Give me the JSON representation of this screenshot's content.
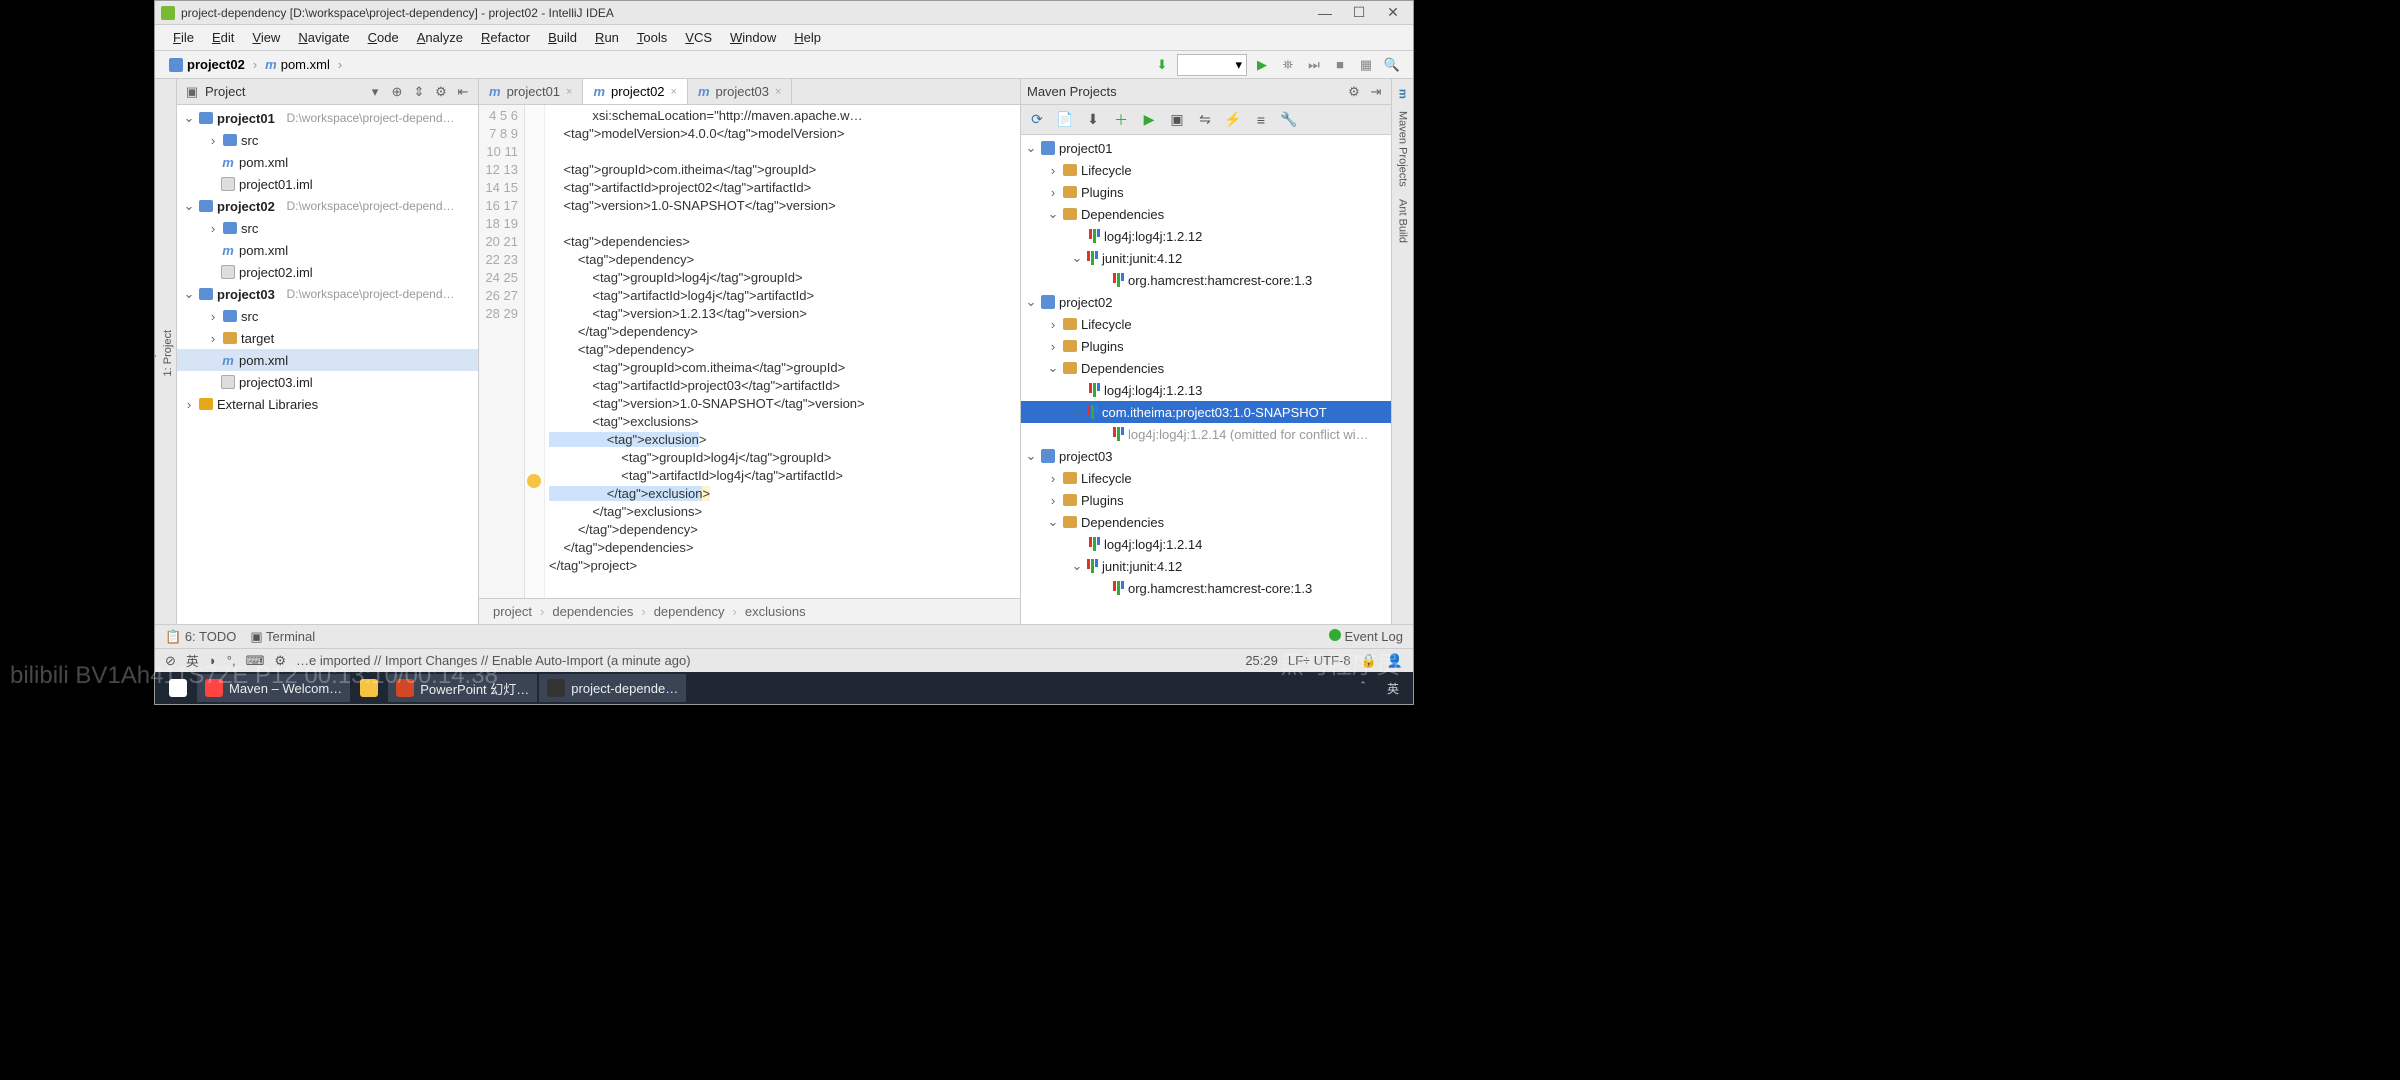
{
  "window": {
    "title": "project-dependency [D:\\workspace\\project-dependency] - project02 - IntelliJ IDEA"
  },
  "menu": [
    "File",
    "Edit",
    "View",
    "Navigate",
    "Code",
    "Analyze",
    "Refactor",
    "Build",
    "Run",
    "Tools",
    "VCS",
    "Window",
    "Help"
  ],
  "breadcrumb": {
    "project": "project02",
    "file": "pom.xml"
  },
  "projectPanel": {
    "title": "Project"
  },
  "tree": {
    "p1": {
      "name": "project01",
      "path": "D:\\workspace\\project-depend…"
    },
    "p1_src": "src",
    "p1_pom": "pom.xml",
    "p1_iml": "project01.iml",
    "p2": {
      "name": "project02",
      "path": "D:\\workspace\\project-depend…"
    },
    "p2_src": "src",
    "p2_pom": "pom.xml",
    "p2_iml": "project02.iml",
    "p3": {
      "name": "project03",
      "path": "D:\\workspace\\project-depend…"
    },
    "p3_src": "src",
    "p3_target": "target",
    "p3_pom": "pom.xml",
    "p3_iml": "project03.iml",
    "ext": "External Libraries"
  },
  "tabs": [
    "project01",
    "project02",
    "project03"
  ],
  "editor": {
    "startLine": 4,
    "lines": [
      "            xsi:schemaLocation=\"http://maven.apache.w…",
      "    <modelVersion>4.0.0</modelVersion>",
      "",
      "    <groupId>com.itheima</groupId>",
      "    <artifactId>project02</artifactId>",
      "    <version>1.0-SNAPSHOT</version>",
      "",
      "    <dependencies>",
      "        <dependency>",
      "            <groupId>log4j</groupId>",
      "            <artifactId>log4j</artifactId>",
      "            <version>1.2.13</version>",
      "        </dependency>",
      "        <dependency>",
      "            <groupId>com.itheima</groupId>",
      "            <artifactId>project03</artifactId>",
      "            <version>1.0-SNAPSHOT</version>",
      "            <exclusions>",
      "                <exclusion>",
      "                    <groupId>log4j</groupId>",
      "                    <artifactId>log4j</artifactId>",
      "                </exclusion>",
      "            </exclusions>",
      "        </dependency>",
      "    </dependencies>",
      "</project>"
    ],
    "crumbs": [
      "project",
      "dependencies",
      "dependency",
      "exclusions"
    ]
  },
  "mavenPanel": {
    "title": "Maven Projects"
  },
  "maven": {
    "p1": "project01",
    "p1_life": "Lifecycle",
    "p1_plug": "Plugins",
    "p1_dep": "Dependencies",
    "p1_d1": "log4j:log4j:1.2.12",
    "p1_d2": "junit:junit:4.12",
    "p1_d2a": "org.hamcrest:hamcrest-core:1.3",
    "p2": "project02",
    "p2_life": "Lifecycle",
    "p2_plug": "Plugins",
    "p2_dep": "Dependencies",
    "p2_d1": "log4j:log4j:1.2.13",
    "p2_d2": "com.itheima:project03:1.0-SNAPSHOT",
    "p2_d2a": "log4j:log4j:1.2.14 (omitted for conflict wi…",
    "p3": "project03",
    "p3_life": "Lifecycle",
    "p3_plug": "Plugins",
    "p3_dep": "Dependencies",
    "p3_d1": "log4j:log4j:1.2.14",
    "p3_d2": "junit:junit:4.12",
    "p3_d2a": "org.hamcrest:hamcrest-core:1.3"
  },
  "bottom": {
    "todo": "6: TODO",
    "terminal": "Terminal",
    "eventlog": "Event Log"
  },
  "status": {
    "msg": "…e imported // Import Changes // Enable Auto-Import (a minute ago)",
    "pos": "25:29",
    "enc": "LF÷  UTF-8"
  },
  "taskbar": {
    "chrome": "Maven – Welcom…",
    "ppt": "PowerPoint 幻灯…",
    "idea": "project-depende…"
  },
  "watermark": {
    "left": "bilibili  BV1Ah411S7ZE  P12  00:13:10/00:14:38",
    "right": "黑马程序员"
  }
}
